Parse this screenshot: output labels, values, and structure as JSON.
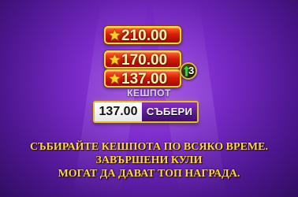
{
  "prizes": [
    {
      "value": "210.00",
      "icon": "star-icon"
    },
    {
      "value": "170.00",
      "icon": "star-icon"
    },
    {
      "value": "137.00",
      "icon": "star-icon"
    }
  ],
  "multiplier_badge": {
    "count": "3",
    "icon": "up-arrow-icon"
  },
  "cashpot": {
    "label": "КЕШПОТ",
    "value": "137.00",
    "collect_label": "СЪБЕРИ"
  },
  "message": {
    "line1": "СЪБИРАЙТЕ КЕШПОТА ПО ВСЯКО ВРЕМЕ.",
    "line2": "ЗАВЪРШЕНИ КУЛИ",
    "line3": "МОГАТ ДА ДАВАТ ТОП НАГРАДА."
  },
  "colors": {
    "prize_fill": "#d81d0b",
    "prize_border": "#f7d34b",
    "message_text": "#ffd04a",
    "background": "#4d168f",
    "collect_button": "#5b1a93"
  }
}
